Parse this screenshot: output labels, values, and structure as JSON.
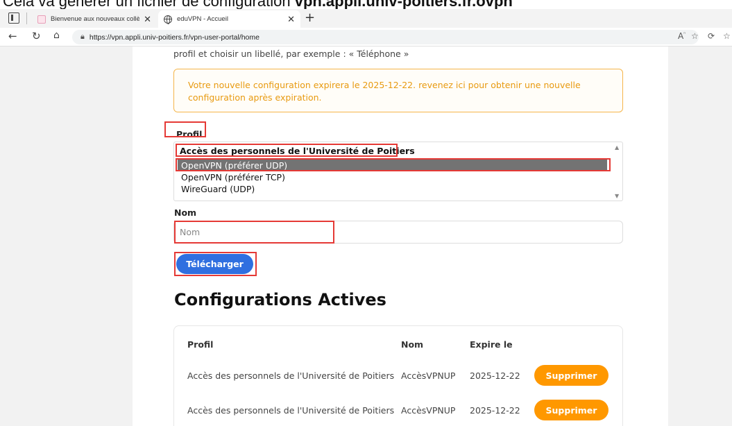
{
  "caption": {
    "text": "Cela va générer un fichier de configuration ",
    "bold": "vpn.appli.univ-poitiers.fr.ovpn"
  },
  "browser": {
    "tabs": [
      {
        "label": "Bienvenue aux nouveaux collègues",
        "active": false
      },
      {
        "label": "eduVPN - Accueil",
        "active": true
      }
    ],
    "url": "https://vpn.appli.univ-poitiers.fr/vpn-user-portal/home"
  },
  "page": {
    "intro": "profil et choisir un libellé, par exemple : « Téléphone »",
    "notice": "Votre nouvelle configuration expirera le 2025-12-22. revenez ici pour obtenir une nouvelle configuration après expiration.",
    "profil_label": "Profil",
    "profile_group": "Accès des personnels de l'Université de Poitiers",
    "profile_options": [
      "OpenVPN (préférer UDP)",
      "OpenVPN (préférer TCP)",
      "WireGuard (UDP)"
    ],
    "selected_option": "OpenVPN (préférer UDP)",
    "nom_label": "Nom",
    "nom_placeholder": "Nom",
    "download_label": "Télécharger",
    "active_title": "Configurations Actives",
    "table": {
      "headers": [
        "Profil",
        "Nom",
        "Expire le"
      ],
      "rows": [
        {
          "profil": "Accès des personnels de l'Université de Poitiers",
          "nom": "AccèsVPNUP",
          "expire": "2025-12-22",
          "action": "Supprimer"
        },
        {
          "profil": "Accès des personnels de l'Université de Poitiers",
          "nom": "AccèsVPNUP",
          "expire": "2025-12-22",
          "action": "Supprimer"
        }
      ]
    }
  },
  "colors": {
    "primary": "#2f6fe0",
    "warning": "#ff9800",
    "notice_text": "#e89a10",
    "highlight_box": "#e53935"
  }
}
